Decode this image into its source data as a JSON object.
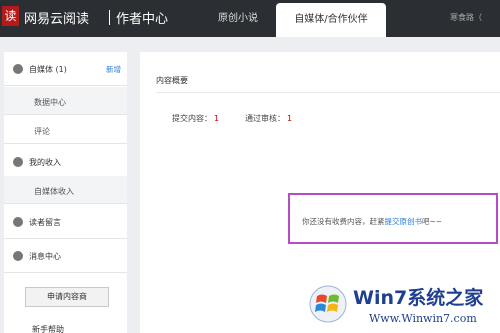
{
  "header": {
    "logo_glyph": "读",
    "brand": "网易云阅读",
    "sub_brand": "作者中心",
    "tabs": [
      {
        "label": "原创小说",
        "active": false
      },
      {
        "label": "自媒体/合作伙伴",
        "active": true
      }
    ],
    "user_name": "寒食路（"
  },
  "sidebar": {
    "sections": [
      {
        "label": "自媒体 (1)",
        "action": "新增",
        "icon": "user-circle-icon"
      },
      {
        "label": "我的收入",
        "icon": "yen-circle-icon"
      },
      {
        "label": "读者留言",
        "icon": "comment-circle-icon"
      },
      {
        "label": "消息中心",
        "icon": "message-circle-icon"
      }
    ],
    "items": [
      {
        "label": "数据中心",
        "active": true
      },
      {
        "label": "评论",
        "active": false
      },
      {
        "label": "自媒体收入",
        "active": true
      }
    ],
    "apply_button": "申请内容商",
    "help_link": "新手帮助"
  },
  "main": {
    "title": "内容概要",
    "stats": [
      {
        "label": "提交内容：",
        "value": "1"
      },
      {
        "label": "通过审核：",
        "value": "1"
      }
    ],
    "notice_prefix": "你还没有收费内容，赶紧",
    "notice_link": "提交原创书",
    "notice_suffix": "吧~~"
  },
  "watermark": {
    "text": "Win7系统之家",
    "url": "Www.Winwin7.com"
  },
  "colors": {
    "topbar": "#2b2f33",
    "accent_link": "#2a7ad5",
    "stat_value": "#cc0000",
    "notice_border": "#b54ec4"
  }
}
